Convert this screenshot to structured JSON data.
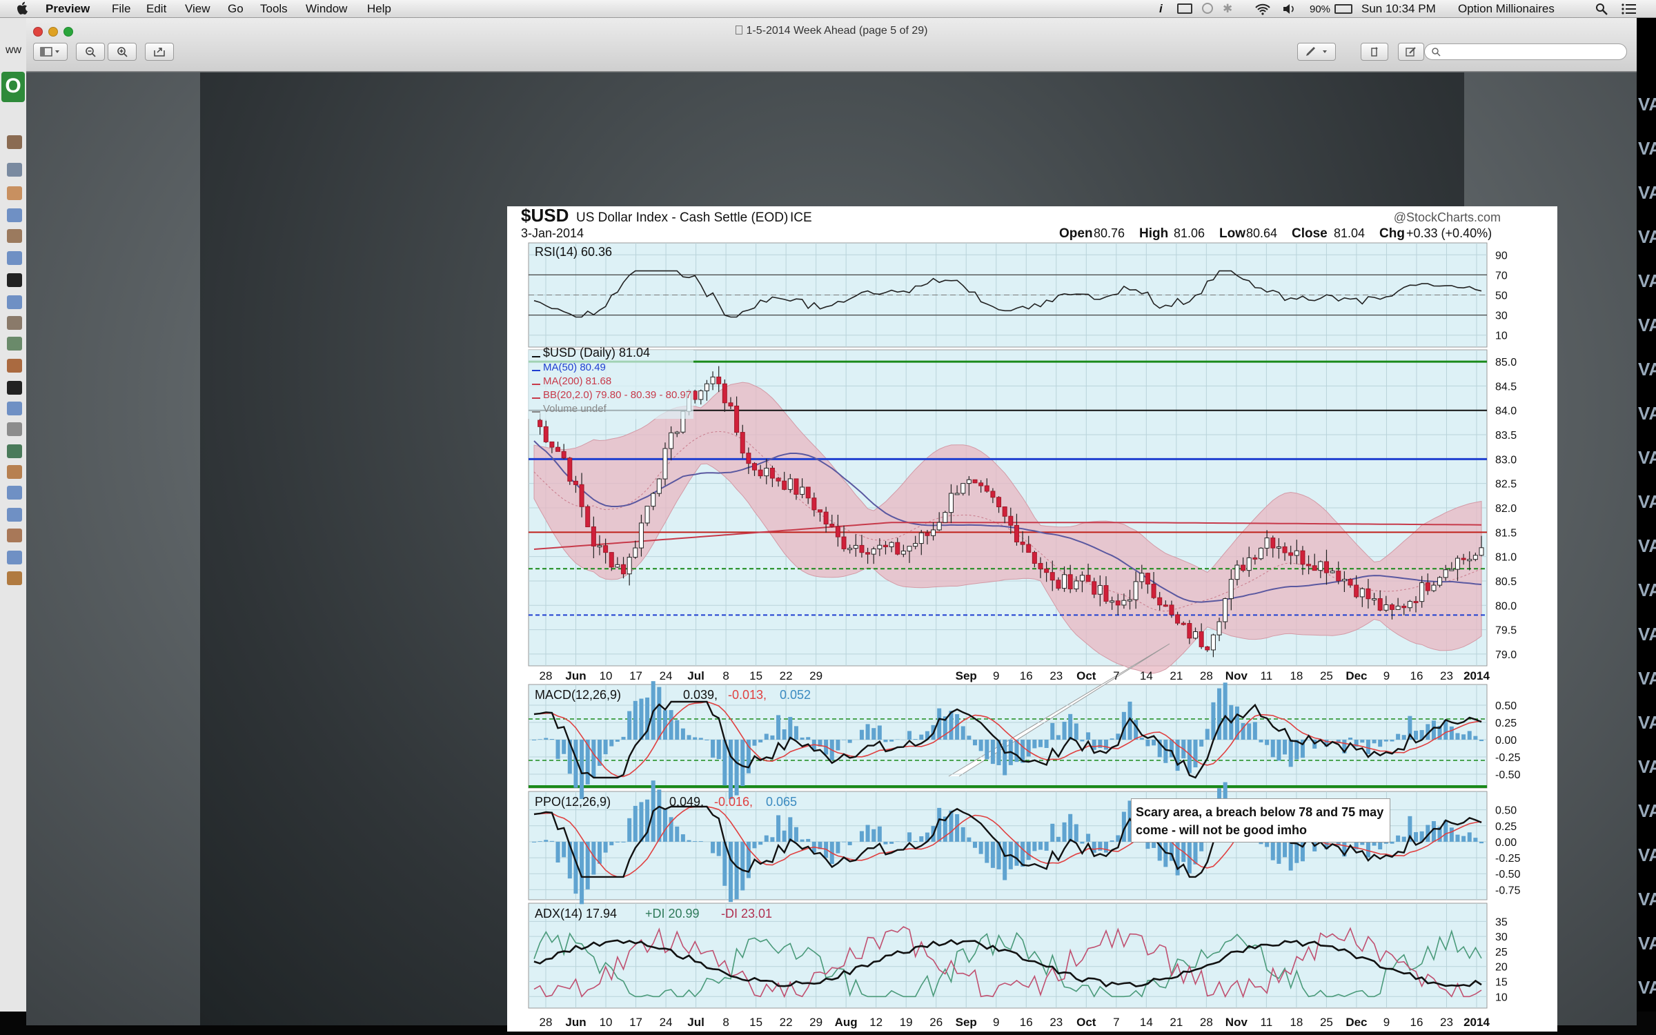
{
  "menubar": {
    "app": "Preview",
    "menus": [
      "File",
      "Edit",
      "View",
      "Go",
      "Tools",
      "Window",
      "Help"
    ],
    "battery": "90%",
    "clock": "Sun 10:34 PM",
    "user": "Option Millionaires"
  },
  "desktop": {
    "left_edge_text": "ww",
    "left_badge": "O",
    "right_edge_text": [
      "VA",
      "VA",
      "VA",
      "VA",
      "VA",
      "VA",
      "VA",
      "VA",
      "VA",
      "VA",
      "VA",
      "VA",
      "VA",
      "VA",
      "VA",
      "VA",
      "VA",
      "VA",
      "VA",
      "VA",
      "VA"
    ]
  },
  "window": {
    "title": "1-5-2014 Week Ahead (page 5 of 29)"
  },
  "chart": {
    "header": {
      "symbol": "$USD",
      "name": "US Dollar Index - Cash Settle (EOD)",
      "exchange": "ICE",
      "source": "@StockCharts.com",
      "date": "3-Jan-2014",
      "open_label": "Open",
      "open": "80.76",
      "high_label": "High",
      "high": "81.06",
      "low_label": "Low",
      "low": "80.64",
      "close_label": "Close",
      "close": "81.04",
      "chg_label": "Chg",
      "chg": "+0.33 (+0.40%)"
    },
    "rsi": {
      "label": "RSI(14) 60.36",
      "ticks": [
        "90",
        "70",
        "50",
        "30",
        "10"
      ]
    },
    "price": {
      "legend": [
        "$USD (Daily) 81.04",
        "MA(50) 80.49",
        "MA(200) 81.68",
        "BB(20,2.0) 79.80 - 80.39 - 80.97",
        "Volume undef"
      ],
      "ticks": [
        "85.0",
        "84.5",
        "84.0",
        "83.5",
        "83.0",
        "82.5",
        "82.0",
        "81.5",
        "81.0",
        "80.5",
        "80.0",
        "79.5",
        "79.0"
      ]
    },
    "macd": {
      "title": "MACD(12,26,9)",
      "v1": "0.039,",
      "v2": "-0.013,",
      "v3": "0.052",
      "ticks": [
        "0.50",
        "0.25",
        "0.00",
        "-0.25",
        "-0.50"
      ]
    },
    "ppo": {
      "title": "PPO(12,26,9)",
      "v1": "0.049,",
      "v2": "-0.016,",
      "v3": "0.065",
      "ticks": [
        "0.50",
        "0.25",
        "0.00",
        "-0.25",
        "-0.50",
        "-0.75"
      ]
    },
    "adx": {
      "title": "ADX(14) 17.94",
      "v1": "+DI 20.99",
      "v2": "-DI 23.01",
      "ticks": [
        "35",
        "30",
        "25",
        "20",
        "15",
        "10"
      ]
    },
    "x_labels_mid": [
      "28",
      "Jun",
      "10",
      "17",
      "24",
      "Jul",
      "8",
      "15",
      "22",
      "29",
      "",
      "",
      "",
      "",
      "Sep",
      "9",
      "16",
      "23",
      "Oct",
      "7",
      "14",
      "21",
      "28",
      "Nov",
      "11",
      "18",
      "25",
      "Dec",
      "9",
      "16",
      "23",
      "2014"
    ],
    "x_labels_bottom": [
      "28",
      "Jun",
      "10",
      "17",
      "24",
      "Jul",
      "8",
      "15",
      "22",
      "29",
      "Aug",
      "12",
      "19",
      "26",
      "Sep",
      "9",
      "16",
      "23",
      "Oct",
      "7",
      "14",
      "21",
      "28",
      "Nov",
      "11",
      "18",
      "25",
      "Dec",
      "9",
      "16",
      "23",
      "2014"
    ],
    "annotation": "Scary area, a breach below 78 and 75 may come - will not be good imho"
  },
  "chart_data": {
    "type": "line",
    "title": "$USD US Dollar Index - Cash Settle (EOD) ICE",
    "x": [
      "28",
      "Jun",
      "10",
      "17",
      "24",
      "Jul",
      "8",
      "15",
      "22",
      "29",
      "Aug",
      "12",
      "19",
      "26",
      "Sep",
      "9",
      "16",
      "23",
      "Oct",
      "7",
      "14",
      "21",
      "28",
      "Nov",
      "11",
      "18",
      "25",
      "Dec",
      "9",
      "16",
      "23",
      "2014"
    ],
    "series": [
      {
        "name": "$USD (Daily) 81.04",
        "values": [
          83.8,
          83.0,
          81.2,
          80.7,
          82.6,
          84.2,
          84.7,
          82.9,
          82.6,
          82.2,
          81.3,
          81.2,
          81.1,
          81.5,
          82.6,
          82.1,
          81.3,
          80.4,
          80.6,
          79.9,
          80.6,
          79.6,
          79.2,
          80.7,
          81.4,
          81.0,
          80.8,
          80.3,
          79.8,
          80.3,
          80.9,
          81.04
        ]
      }
    ],
    "ylim": [
      79,
      85
    ],
    "annotations": [
      "Scary area, a breach below 78 and 75 may come - will not be good imho"
    ]
  }
}
